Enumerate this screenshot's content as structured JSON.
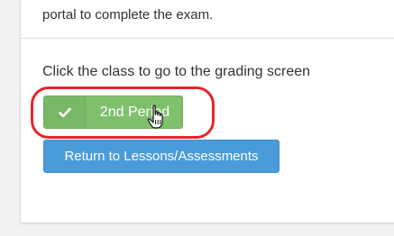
{
  "top_section": {
    "text": "portal to complete the exam."
  },
  "main": {
    "instruction": "Click the class to go to the grading screen",
    "class_button": {
      "label": "2nd Period",
      "icon": "check-icon"
    },
    "return_button": {
      "label": "Return to Lessons/Assessments"
    }
  },
  "colors": {
    "class_button": "#7fc06d",
    "return_button": "#4a9bd9",
    "highlight": "#e5262b"
  },
  "cursor": {
    "icon": "hand-pointer-icon"
  }
}
